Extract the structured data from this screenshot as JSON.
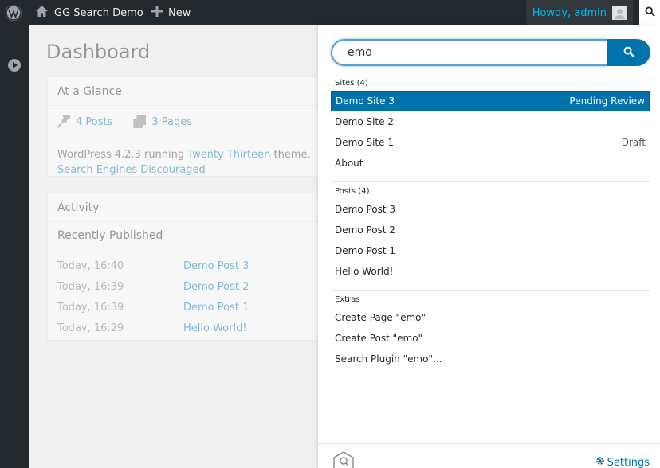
{
  "adminbar": {
    "site_name": "GG Search Demo",
    "new_label": "New",
    "howdy": "Howdy, admin",
    "icons": [
      "wordpress-logo-icon",
      "home-icon",
      "plus-icon",
      "avatar",
      "search-icon"
    ]
  },
  "dashboard": {
    "title": "Dashboard",
    "glance": {
      "title": "At a Glance",
      "posts": "4 Posts",
      "pages": "3 Pages",
      "version_prefix": "WordPress 4.2.3 running ",
      "theme": "Twenty Thirteen",
      "version_suffix": " theme.",
      "search_engines": "Search Engines Discouraged"
    },
    "activity": {
      "title": "Activity",
      "recent": "Recently Published",
      "rows": [
        {
          "date": "Today, 16:40",
          "title": "Demo Post 3"
        },
        {
          "date": "Today, 16:39",
          "title": "Demo Post 2"
        },
        {
          "date": "Today, 16:39",
          "title": "Demo Post 1"
        },
        {
          "date": "Today, 16:29",
          "title": "Hello World!"
        }
      ]
    }
  },
  "search": {
    "query": "emo",
    "groups": {
      "sites": {
        "heading": "Sites (4)",
        "items": [
          {
            "label": "Demo Site 3",
            "status": "Pending Review"
          },
          {
            "label": "Demo Site 2",
            "status": ""
          },
          {
            "label": "Demo Site 1",
            "status": "Draft"
          },
          {
            "label": "About",
            "status": ""
          }
        ]
      },
      "posts": {
        "heading": "Posts (4)",
        "items": [
          {
            "label": "Demo Post 3"
          },
          {
            "label": "Demo Post 2"
          },
          {
            "label": "Demo Post 1"
          },
          {
            "label": "Hello World!"
          }
        ]
      },
      "extras": {
        "heading": "Extras",
        "items": [
          {
            "label": "Create Page \"emo\""
          },
          {
            "label": "Create Post \"emo\""
          },
          {
            "label": "Search Plugin \"emo\"..."
          }
        ]
      }
    },
    "settings_label": "Settings"
  },
  "colors": {
    "accent": "#0073aa",
    "adminbar_bg": "#23282d",
    "howdy_text": "#00b9eb"
  }
}
